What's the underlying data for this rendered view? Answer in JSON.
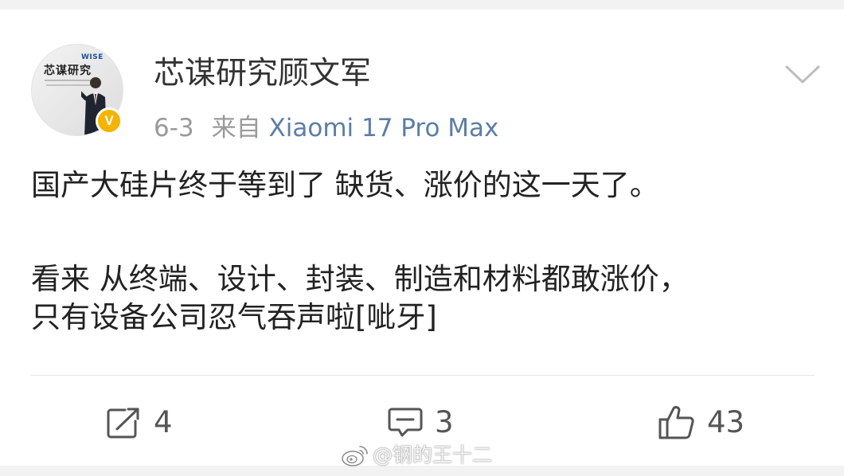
{
  "post": {
    "author": {
      "name": "芯谋研究顾文军",
      "verified_badge": "V",
      "avatar_text": "芯谋研究",
      "avatar_brand": "WISE"
    },
    "meta": {
      "date": "6-3",
      "source_prefix": "来自",
      "source_device": "Xiaomi 17 Pro Max"
    },
    "content": {
      "line1": "国产大硅片终于等到了 缺货、涨价的这一天了。",
      "line2": "看来 从终端、设计、封装、制造和材料都敢涨价，",
      "line3": "只有设备公司忍气吞声啦[呲牙]"
    },
    "actions": {
      "repost_count": "4",
      "comment_count": "3",
      "like_count": "43"
    }
  },
  "watermark": {
    "text": "@钢的王十二"
  },
  "icons": {
    "more": "chevron-down-icon",
    "repost": "repost-icon",
    "comment": "comment-icon",
    "like": "thumbs-up-icon",
    "watermark": "weibo-logo-icon"
  },
  "colors": {
    "verified": "#f4b400",
    "source_link": "#5b7ea6",
    "meta_gray": "#9a9a9a",
    "text": "#222222"
  }
}
